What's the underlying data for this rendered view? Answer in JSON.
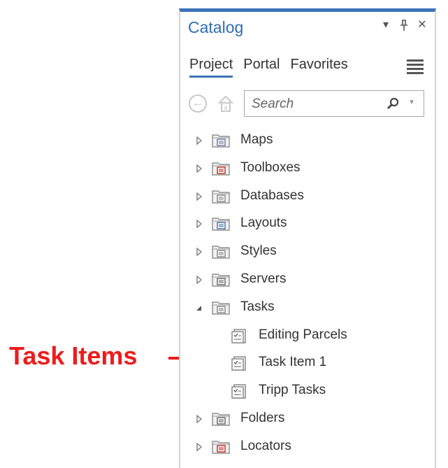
{
  "annotation": {
    "label": "Task Items",
    "color": "#ee1c1c"
  },
  "pane": {
    "title": "Catalog",
    "accent": "#3b73b9",
    "controls": [
      "chevron-down-icon",
      "pin-icon",
      "close-icon"
    ]
  },
  "tabs": [
    {
      "label": "Project",
      "active": true
    },
    {
      "label": "Portal",
      "active": false
    },
    {
      "label": "Favorites",
      "active": false
    }
  ],
  "search": {
    "placeholder": "Search"
  },
  "tree": [
    {
      "label": "Maps",
      "icon": "maps-folder-icon",
      "expanded": false
    },
    {
      "label": "Toolboxes",
      "icon": "toolboxes-folder-icon",
      "expanded": false
    },
    {
      "label": "Databases",
      "icon": "databases-folder-icon",
      "expanded": false
    },
    {
      "label": "Layouts",
      "icon": "layouts-folder-icon",
      "expanded": false
    },
    {
      "label": "Styles",
      "icon": "styles-folder-icon",
      "expanded": false
    },
    {
      "label": "Servers",
      "icon": "servers-folder-icon",
      "expanded": false
    },
    {
      "label": "Tasks",
      "icon": "tasks-folder-icon",
      "expanded": true
    },
    {
      "label": "Editing Parcels",
      "icon": "task-item-icon",
      "child": true
    },
    {
      "label": "Task Item 1",
      "icon": "task-item-icon",
      "child": true
    },
    {
      "label": "Tripp Tasks",
      "icon": "task-item-icon",
      "child": true
    },
    {
      "label": "Folders",
      "icon": "folders-folder-icon",
      "expanded": false
    },
    {
      "label": "Locators",
      "icon": "locators-folder-icon",
      "expanded": false
    }
  ]
}
